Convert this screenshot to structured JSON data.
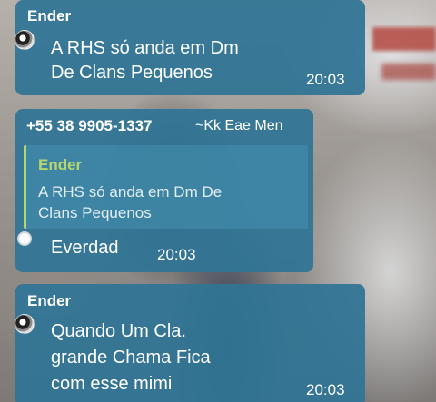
{
  "messages": [
    {
      "sender": "Ender",
      "text_line1": "A RHS só anda em Dm",
      "text_line2": "De Clans Pequenos",
      "time": "20:03"
    },
    {
      "sender_phone": "+55 38 9905-1337",
      "sender_nick": "~Kk Eae Men",
      "quote": {
        "sender": "Ender",
        "text_line1": "A RHS só anda em Dm De",
        "text_line2": "Clans Pequenos"
      },
      "text": "Everdad",
      "time": "20:03"
    },
    {
      "sender": "Ender",
      "text_line1": "Quando Um Cla.",
      "text_line2": "grande Chama Fica",
      "text_line3": "com esse mimi",
      "time": "20:03"
    }
  ],
  "colors": {
    "bubble": "#317595",
    "quote_accent": "#b6d66c",
    "text": "#ffffff"
  }
}
